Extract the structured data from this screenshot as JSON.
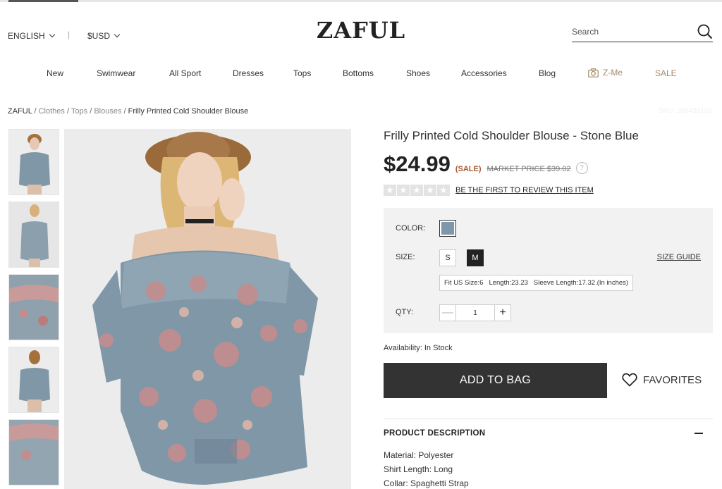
{
  "header": {
    "language": "ENGLISH",
    "separator": "|",
    "currency": "$USD",
    "logo": "ZAFUL",
    "search_placeholder": "Search"
  },
  "nav": {
    "items": [
      "New",
      "Swimwear",
      "All Sport",
      "Dresses",
      "Tops",
      "Bottoms",
      "Shoes",
      "Accessories",
      "Blog"
    ],
    "zme": "Z-Me",
    "sale": "SALE",
    "accent_color": "#a58b6a"
  },
  "breadcrumb": {
    "items": [
      "ZAFUL",
      "Clothes",
      "Tops",
      "Blouses"
    ],
    "current": "Frilly Printed Cold Shoulder Blouse",
    "sku": "SKU: 208433102"
  },
  "product": {
    "title": "Frilly Printed Cold Shoulder Blouse - Stone Blue",
    "price": "$24.99",
    "sale_tag": "(SALE)",
    "market_price": "MARKET PRICE $39.02",
    "help_icon": "?",
    "rating_stars": 0,
    "review_link": "BE THE FIRST TO REVIEW THIS ITEM",
    "color_label": "COLOR:",
    "color_swatch": "#7f97a7",
    "size_label": "SIZE:",
    "sizes": [
      "S",
      "M"
    ],
    "selected_size": "M",
    "size_guide": "SIZE GUIDE",
    "fit_info": {
      "fit": "Fit US Size:6",
      "length": "Length:23.23",
      "sleeve": "Sleeve Length:17.32.(In inches)"
    },
    "qty_label": "QTY:",
    "qty_value": "1",
    "availability": "Availability: In Stock",
    "add_to_bag": "ADD TO BAG",
    "favorites": "FAVORITES"
  },
  "description": {
    "title": "PRODUCT DESCRIPTION",
    "lines": [
      "Material: Polyester",
      "Shirt Length: Long",
      "Collar: Spaghetti Strap"
    ]
  }
}
